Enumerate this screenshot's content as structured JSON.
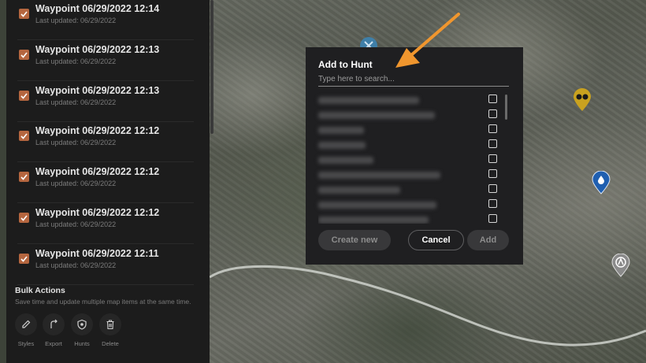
{
  "waypoints": [
    {
      "title": "Waypoint 06/29/2022 12:14",
      "subtitle": "Last updated: 06/29/2022",
      "checked": true
    },
    {
      "title": "Waypoint 06/29/2022 12:13",
      "subtitle": "Last updated: 06/29/2022",
      "checked": true
    },
    {
      "title": "Waypoint 06/29/2022 12:13",
      "subtitle": "Last updated: 06/29/2022",
      "checked": true
    },
    {
      "title": "Waypoint 06/29/2022 12:12",
      "subtitle": "Last updated: 06/29/2022",
      "checked": true
    },
    {
      "title": "Waypoint 06/29/2022 12:12",
      "subtitle": "Last updated: 06/29/2022",
      "checked": true
    },
    {
      "title": "Waypoint 06/29/2022 12:12",
      "subtitle": "Last updated: 06/29/2022",
      "checked": true
    },
    {
      "title": "Waypoint 06/29/2022 12:11",
      "subtitle": "Last updated: 06/29/2022",
      "checked": true
    }
  ],
  "bulk": {
    "title": "Bulk Actions",
    "description": "Save time and update multiple map items at the same time.",
    "actions": [
      {
        "label": "Styles",
        "icon": "pencil-icon"
      },
      {
        "label": "Export",
        "icon": "export-icon"
      },
      {
        "label": "Hunts",
        "icon": "shield-icon"
      },
      {
        "label": "Delete",
        "icon": "trash-icon"
      }
    ]
  },
  "modal": {
    "title": "Add to Hunt",
    "search_placeholder": "Type here to search...",
    "hunt_count": 9,
    "buttons": {
      "create": "Create new",
      "cancel": "Cancel",
      "add": "Add"
    }
  },
  "colors": {
    "accent": "#b5663f",
    "annotation_arrow": "#f0962e",
    "marker_blue": "#1f5fb0",
    "marker_yellow": "#c9a21f",
    "marker_gray": "#8a8a8a"
  }
}
